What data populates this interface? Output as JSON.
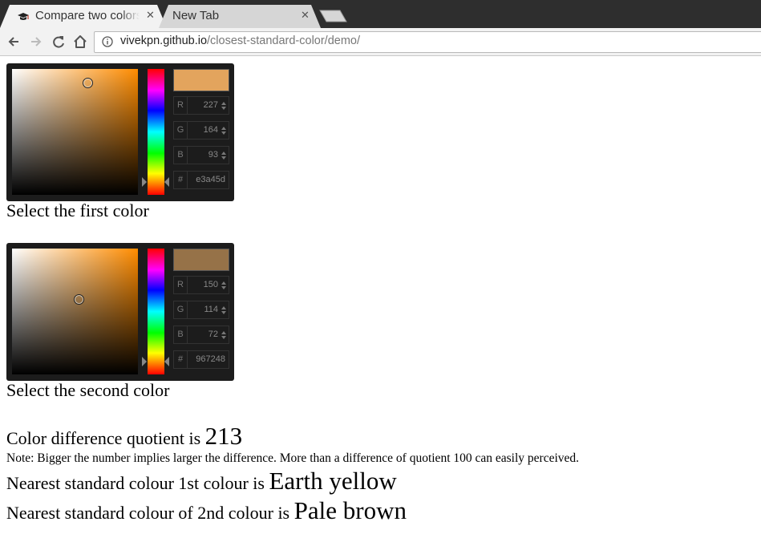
{
  "browser": {
    "tabs": [
      {
        "title": "Compare two colors",
        "active": true,
        "close_icon": "close-icon"
      },
      {
        "title": "New Tab",
        "active": false,
        "close_icon": "close-icon"
      }
    ],
    "url_host": "vivekpn.github.io",
    "url_path": "/closest-standard-color/demo/"
  },
  "pickers": [
    {
      "caption": "Select the first color",
      "swatch": "#e3a45d",
      "hue_color": "#ff8c00",
      "r": "227",
      "g": "164",
      "b": "93",
      "hex": "e3a45d"
    },
    {
      "caption": "Select the second color",
      "swatch": "#967248",
      "hue_color": "#ff8c00",
      "r": "150",
      "g": "114",
      "b": "72",
      "hex": "967248"
    }
  ],
  "result": {
    "diff_label": "Color difference quotient is",
    "diff_value": "213",
    "note": "Note: Bigger the number implies larger the difference. More than a difference of quotient 100 can easily perceived.",
    "nearest1_label": "Nearest standard colour 1st colour is",
    "nearest1_value": "Earth yellow",
    "nearest2_label": "Nearest standard colour of 2nd colour is",
    "nearest2_value": "Pale brown"
  },
  "labels": {
    "r": "R",
    "g": "G",
    "b": "B",
    "hash": "#"
  }
}
